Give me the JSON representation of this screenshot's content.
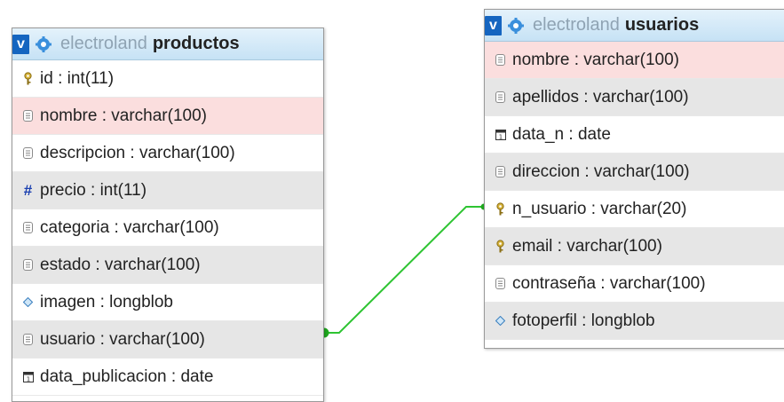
{
  "colors": {
    "header_start": "#e4f2fb",
    "header_end": "#c6e2f5",
    "v_button": "#1565c0",
    "row_white": "#ffffff",
    "row_grey": "#e6e6e6",
    "row_highlight": "#fbdede",
    "relation_line": "#2ec432"
  },
  "productos": {
    "db_name": "electroland",
    "table_name": "productos",
    "toggle_label": "v",
    "columns": [
      {
        "label": "id : int(11)",
        "icon": "key-icon",
        "bg": "white"
      },
      {
        "label": "nombre : varchar(100)",
        "icon": "text-column-icon",
        "bg": "pink"
      },
      {
        "label": "descripcion : varchar(100)",
        "icon": "text-column-icon",
        "bg": "white"
      },
      {
        "label": "precio : int(11)",
        "icon": "numeric-hash-icon",
        "bg": "grey"
      },
      {
        "label": "categoria : varchar(100)",
        "icon": "text-column-icon",
        "bg": "white"
      },
      {
        "label": "estado : varchar(100)",
        "icon": "text-column-icon",
        "bg": "grey"
      },
      {
        "label": "imagen : longblob",
        "icon": "blob-diamond-icon",
        "bg": "white"
      },
      {
        "label": "usuario : varchar(100)",
        "icon": "text-column-icon",
        "bg": "grey"
      },
      {
        "label": "data_publicacion : date",
        "icon": "date-calendar-icon",
        "bg": "white"
      }
    ]
  },
  "usuarios": {
    "db_name": "electroland",
    "table_name": "usuarios",
    "toggle_label": "v",
    "columns": [
      {
        "label": "nombre : varchar(100)",
        "icon": "text-column-icon",
        "bg": "pink"
      },
      {
        "label": "apellidos : varchar(100)",
        "icon": "text-column-icon",
        "bg": "grey"
      },
      {
        "label": "data_n : date",
        "icon": "date-calendar-icon",
        "bg": "white"
      },
      {
        "label": "direccion : varchar(100)",
        "icon": "text-column-icon",
        "bg": "grey"
      },
      {
        "label": "n_usuario : varchar(20)",
        "icon": "key-icon",
        "bg": "white"
      },
      {
        "label": "email : varchar(100)",
        "icon": "key-icon",
        "bg": "grey"
      },
      {
        "label": "contraseña : varchar(100)",
        "icon": "text-column-icon",
        "bg": "white"
      },
      {
        "label": "fotoperfil : longblob",
        "icon": "blob-diamond-icon",
        "bg": "grey"
      }
    ]
  }
}
